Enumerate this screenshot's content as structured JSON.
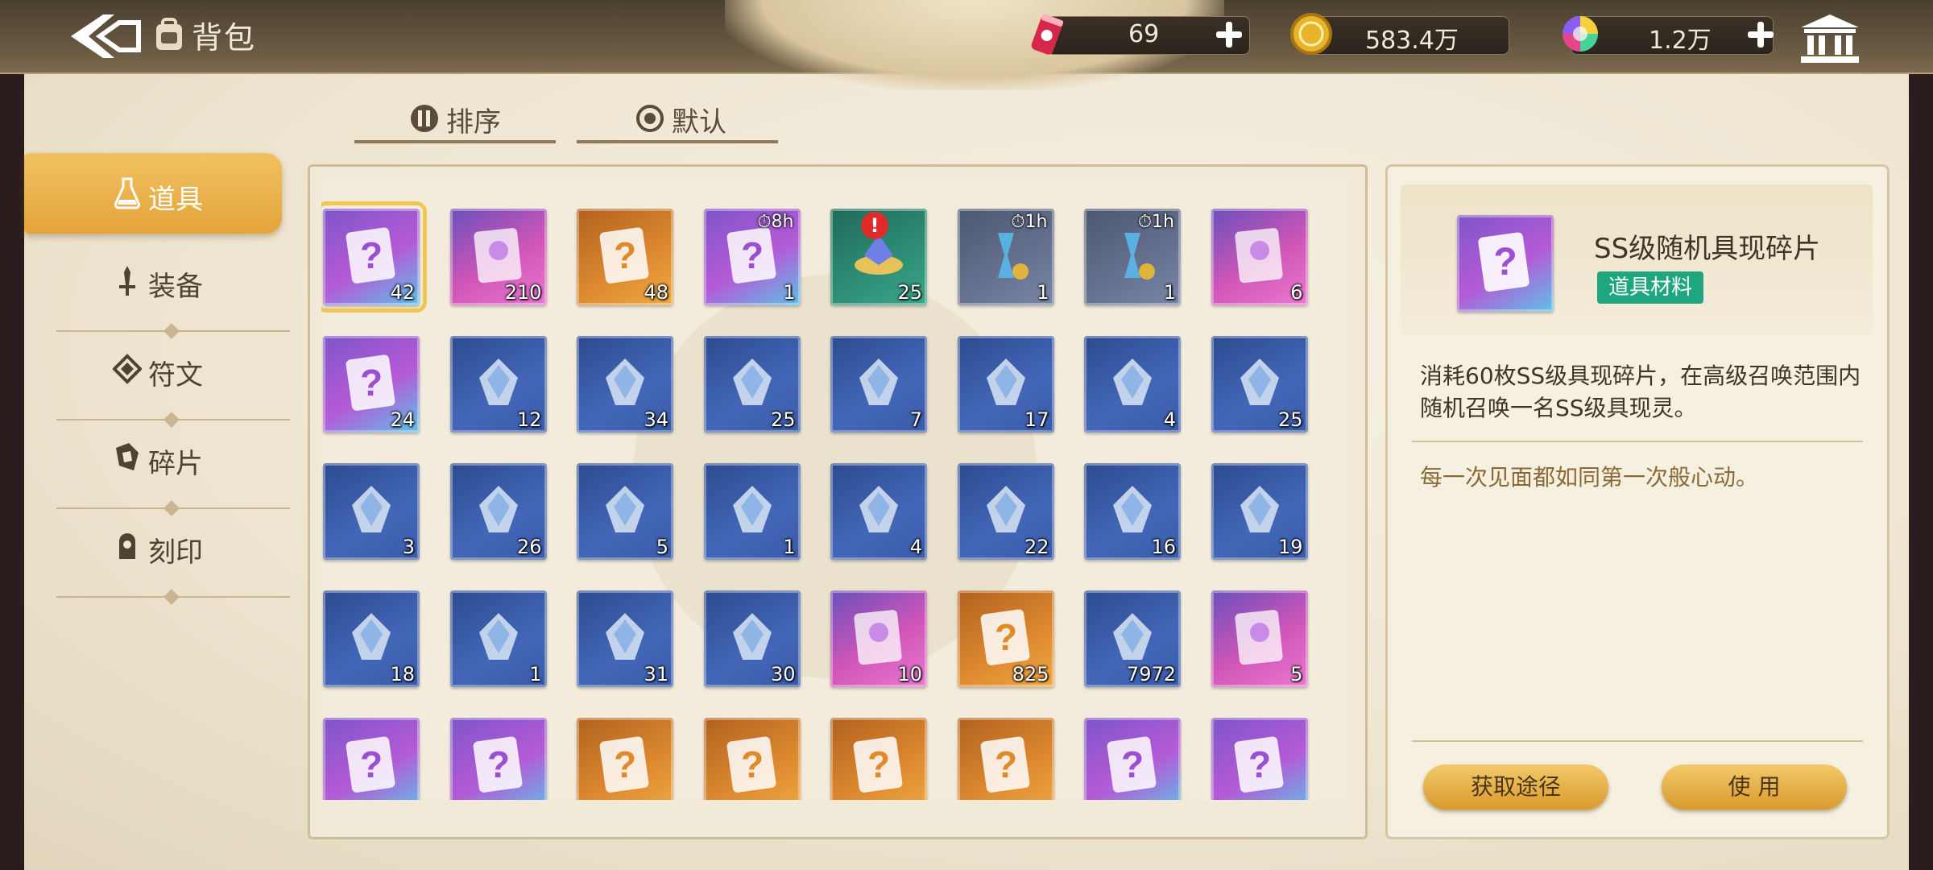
{
  "header": {
    "title": "背包",
    "resources": [
      {
        "icon": "energy-drink-icon",
        "value": "69"
      },
      {
        "icon": "gold-coin-icon",
        "value": "583.4万"
      },
      {
        "icon": "rainbow-gem-icon",
        "value": "1.2万"
      }
    ]
  },
  "sortbar": {
    "sort_label": "排序",
    "default_label": "默认"
  },
  "categories": [
    {
      "label": "道具",
      "icon": "potion-icon",
      "active": true
    },
    {
      "label": "装备",
      "icon": "sword-icon",
      "active": false
    },
    {
      "label": "符文",
      "icon": "rune-icon",
      "active": false
    },
    {
      "label": "碎片",
      "icon": "shard-icon",
      "active": false
    },
    {
      "label": "刻印",
      "icon": "seal-icon",
      "active": false
    }
  ],
  "items": [
    {
      "name": "ss-random-shard",
      "count": "42",
      "rarity": "purple",
      "timer": ""
    },
    {
      "name": "character-shard",
      "count": "210",
      "rarity": "pink",
      "timer": ""
    },
    {
      "name": "random-shard-orange",
      "count": "48",
      "rarity": "orange",
      "timer": ""
    },
    {
      "name": "hourglass-crystal",
      "count": "1",
      "rarity": "purple",
      "timer": "8h"
    },
    {
      "name": "crystal-bowl",
      "count": "25",
      "rarity": "green",
      "timer": ""
    },
    {
      "name": "hourglass-coins",
      "count": "1",
      "rarity": "gray",
      "timer": "1h"
    },
    {
      "name": "hourglass-crystal-2",
      "count": "1",
      "rarity": "gray",
      "timer": "1h"
    },
    {
      "name": "flower-bouquet",
      "count": "6",
      "rarity": "pink",
      "timer": ""
    },
    {
      "name": "robot-toy",
      "count": "24",
      "rarity": "purple",
      "timer": ""
    },
    {
      "name": "green-crystal",
      "count": "12",
      "rarity": "blue",
      "timer": ""
    },
    {
      "name": "white-stone",
      "count": "34",
      "rarity": "blue",
      "timer": ""
    },
    {
      "name": "leaf",
      "count": "25",
      "rarity": "blue",
      "timer": ""
    },
    {
      "name": "purple-ore",
      "count": "7",
      "rarity": "blue",
      "timer": ""
    },
    {
      "name": "water-bowl",
      "count": "17",
      "rarity": "blue",
      "timer": ""
    },
    {
      "name": "orange-potion",
      "count": "4",
      "rarity": "blue",
      "timer": ""
    },
    {
      "name": "pink-teapot",
      "count": "25",
      "rarity": "blue",
      "timer": ""
    },
    {
      "name": "red-potion",
      "count": "3",
      "rarity": "blue",
      "timer": ""
    },
    {
      "name": "grain-pile",
      "count": "26",
      "rarity": "blue",
      "timer": ""
    },
    {
      "name": "blue-cloth",
      "count": "5",
      "rarity": "blue",
      "timer": ""
    },
    {
      "name": "potatoes",
      "count": "1",
      "rarity": "blue",
      "timer": ""
    },
    {
      "name": "golden-apple",
      "count": "4",
      "rarity": "blue",
      "timer": ""
    },
    {
      "name": "umbrella",
      "count": "22",
      "rarity": "blue",
      "timer": ""
    },
    {
      "name": "lighter",
      "count": "16",
      "rarity": "blue",
      "timer": ""
    },
    {
      "name": "open-book",
      "count": "19",
      "rarity": "blue",
      "timer": ""
    },
    {
      "name": "leather-book",
      "count": "18",
      "rarity": "blue",
      "timer": ""
    },
    {
      "name": "milk-carton",
      "count": "1",
      "rarity": "blue",
      "timer": ""
    },
    {
      "name": "medal",
      "count": "31",
      "rarity": "blue",
      "timer": ""
    },
    {
      "name": "pink-pillow",
      "count": "30",
      "rarity": "blue",
      "timer": ""
    },
    {
      "name": "blue-gem",
      "count": "10",
      "rarity": "pink",
      "timer": ""
    },
    {
      "name": "purple-crystal",
      "count": "825",
      "rarity": "orange",
      "timer": ""
    },
    {
      "name": "ice-crystal",
      "count": "7972",
      "rarity": "blue",
      "timer": ""
    },
    {
      "name": "cat-robot",
      "count": "5",
      "rarity": "pink",
      "timer": ""
    },
    {
      "name": "dark-dagger",
      "count": "",
      "rarity": "purple",
      "timer": ""
    },
    {
      "name": "ticket-card",
      "count": "",
      "rarity": "purple",
      "timer": ""
    },
    {
      "name": "blue-pyramid",
      "count": "",
      "rarity": "orange",
      "timer": ""
    },
    {
      "name": "owl-robot",
      "count": "",
      "rarity": "orange",
      "timer": ""
    },
    {
      "name": "red-crystal",
      "count": "",
      "rarity": "orange",
      "timer": ""
    },
    {
      "name": "gold-badge",
      "count": "",
      "rarity": "orange",
      "timer": ""
    },
    {
      "name": "purple-ticket",
      "count": "",
      "rarity": "purple",
      "timer": ""
    },
    {
      "name": "golden-key",
      "count": "",
      "rarity": "purple",
      "timer": ""
    }
  ],
  "detail": {
    "name": "SS级随机具现碎片",
    "tag": "道具材料",
    "description": "消耗60枚SS级具现碎片，在高级召唤范围内随机召唤一名SS级具现灵。",
    "flavor": "每一次见面都如同第一次般心动。",
    "obtain_label": "获取途径",
    "use_label": "使 用"
  },
  "colors": {
    "accent": "#e9ad42",
    "tag_green": "#1fa67e",
    "alert_red": "#e02b2b"
  }
}
